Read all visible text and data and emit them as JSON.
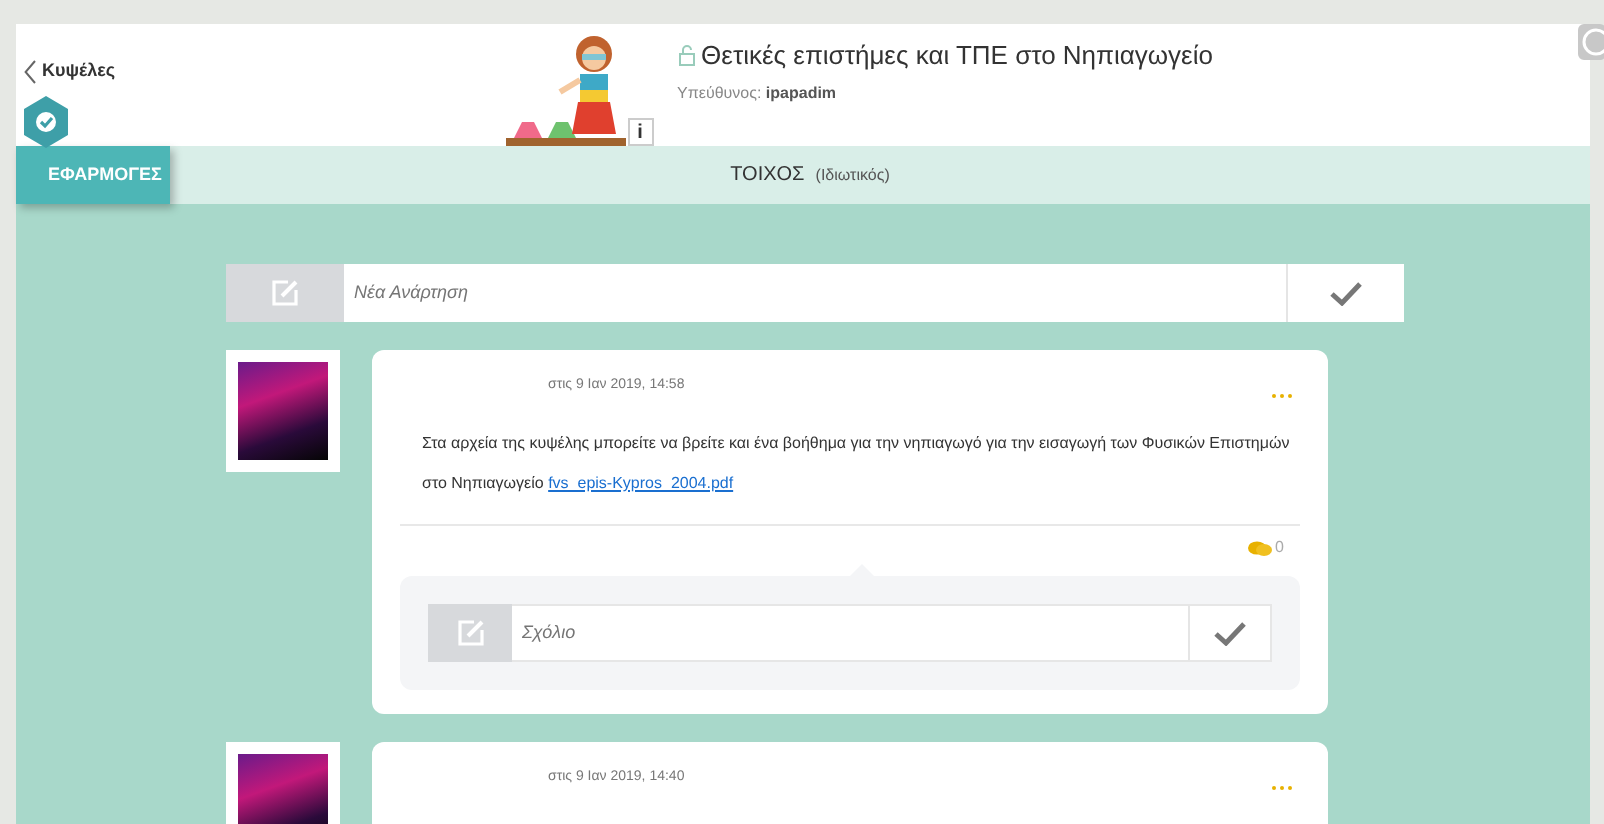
{
  "header": {
    "back_label": "Κυψέλες",
    "title": "Θετικές επιστήμες και ΤΠΕ στο Νηπιαγωγείο",
    "owner_label": "Υπεύθυνος:",
    "owner": "ipapadim",
    "info_label": "i"
  },
  "subbar": {
    "apps_label": "ΕΦΑΡΜΟΓΕΣ",
    "title": "ΤΟΙΧΟΣ",
    "subtitle": "(Ιδιωτικός)"
  },
  "new_post": {
    "placeholder": "Νέα Ανάρτηση"
  },
  "posts": [
    {
      "date": "στις 9 Ιαν 2019, 14:58",
      "text": "Στα αρχεία της κυψέλης μπορείτε να βρείτε και ένα βοήθημα για την νηπιαγωγό για την εισαγωγή των Φυσικών Επιστημών στο Νηπιαγωγείο",
      "link": "fvs_epis-Kypros_2004.pdf",
      "comments": "0",
      "comment_placeholder": "Σχόλιο"
    },
    {
      "date": "στις 9 Ιαν 2019, 14:40"
    }
  ]
}
